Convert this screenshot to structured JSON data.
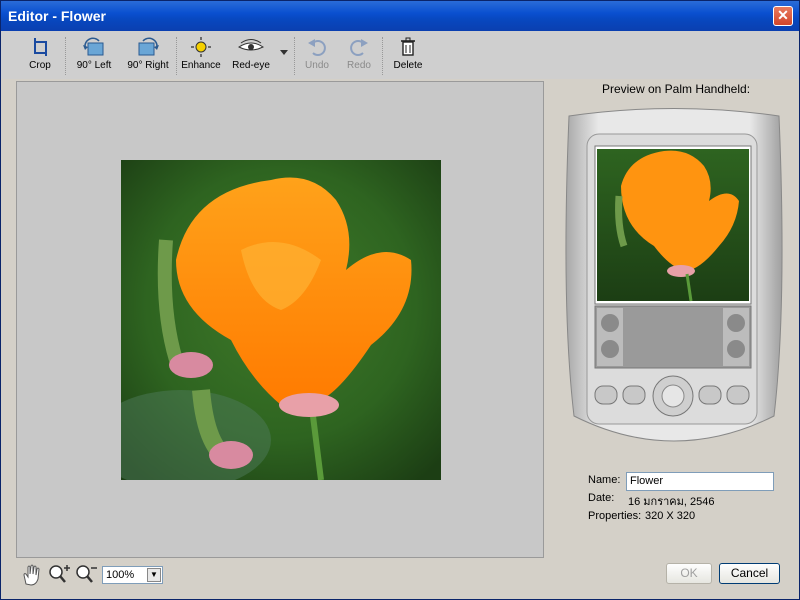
{
  "window": {
    "title": "Editor - Flower",
    "close_glyph": "✕"
  },
  "toolbar": {
    "crop": "Crop",
    "rotate_left": "90° Left",
    "rotate_right": "90° Right",
    "enhance": "Enhance",
    "red_eye": "Red-eye",
    "undo": "Undo",
    "redo": "Redo",
    "delete": "Delete"
  },
  "preview": {
    "title": "Preview on Palm Handheld:"
  },
  "info": {
    "name_label": "Name:",
    "name_value": "Flower",
    "date_label": "Date:",
    "date_value": "16 มกราคม, 2546",
    "properties_label": "Properties:",
    "properties_value": "320 X 320"
  },
  "zoom": {
    "value": "100%"
  },
  "buttons": {
    "ok": "OK",
    "cancel": "Cancel"
  },
  "icons": [
    "crop-icon",
    "rotate-left-icon",
    "rotate-right-icon",
    "enhance-icon",
    "red-eye-icon",
    "undo-icon",
    "redo-icon",
    "delete-icon",
    "hand-icon",
    "zoom-in-icon",
    "zoom-out-icon"
  ]
}
